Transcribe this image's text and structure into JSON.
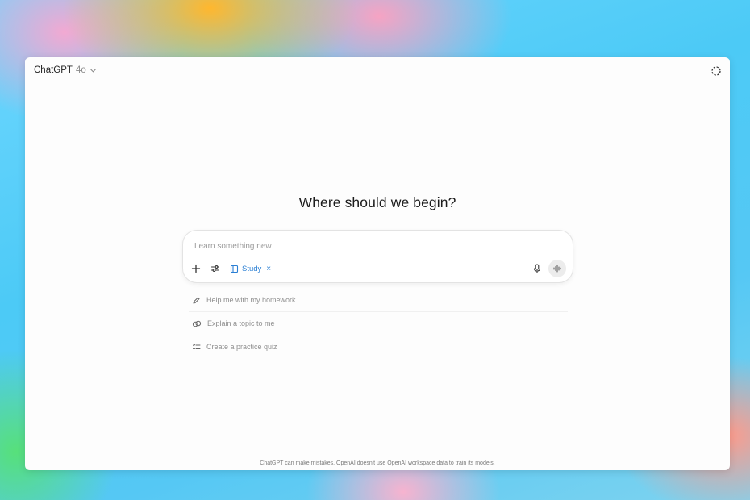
{
  "header": {
    "model_name": "ChatGPT",
    "model_version": "4o",
    "model_dropdown_icon": "chevron-down-icon",
    "corner_icon": "dashed-circle-icon"
  },
  "main": {
    "heading": "Where should we begin?"
  },
  "composer": {
    "placeholder": "Learn something new",
    "value": "",
    "tools": [
      "plus-icon",
      "tools-sliders-icon"
    ],
    "active_chip": {
      "label": "Study",
      "icon": "book-icon",
      "remove_icon": "close-icon"
    },
    "mic_icon": "microphone-icon",
    "voice_icon": "voice-waveform-icon"
  },
  "suggestions": [
    {
      "icon": "pencil-icon",
      "label": "Help me with my homework"
    },
    {
      "icon": "link-icon",
      "label": "Explain a topic to me"
    },
    {
      "icon": "checklist-icon",
      "label": "Create a practice quiz"
    }
  ],
  "footer": {
    "disclaimer": "ChatGPT can make mistakes. OpenAI doesn't use OpenAI workspace data to train its models."
  },
  "colors": {
    "accent": "#2a7fd4",
    "window_bg": "#fdfdfd",
    "muted_text": "#8f8f8f"
  }
}
